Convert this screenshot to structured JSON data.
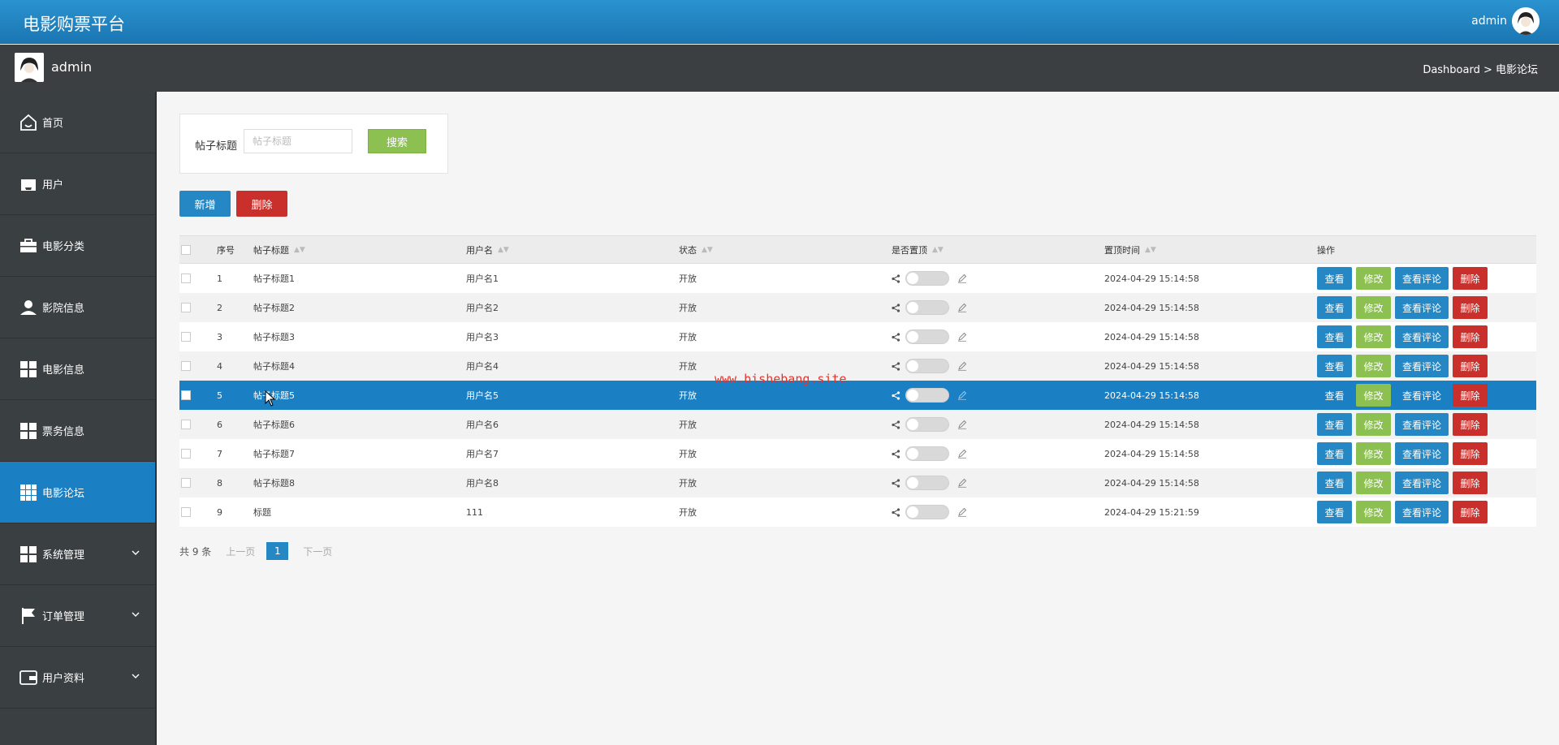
{
  "app": {
    "title": "电影购票平台",
    "user": "admin"
  },
  "subbar": {
    "user": "admin",
    "breadcrumb": "Dashboard > 电影论坛"
  },
  "sidebar": {
    "items": [
      {
        "label": "首页",
        "icon": "home-icon"
      },
      {
        "label": "用户",
        "icon": "inbox-icon"
      },
      {
        "label": "电影分类",
        "icon": "briefcase-icon"
      },
      {
        "label": "影院信息",
        "icon": "person-icon"
      },
      {
        "label": "电影信息",
        "icon": "grid-icon"
      },
      {
        "label": "票务信息",
        "icon": "grid-icon"
      },
      {
        "label": "电影论坛",
        "icon": "grid-small-icon",
        "active": true
      },
      {
        "label": "系统管理",
        "icon": "grid-icon",
        "expandable": true
      },
      {
        "label": "订单管理",
        "icon": "flag-icon",
        "expandable": true
      },
      {
        "label": "用户资料",
        "icon": "wallet-icon",
        "expandable": true
      }
    ]
  },
  "search": {
    "label": "帖子标题",
    "placeholder": "帖子标题",
    "button": "搜索"
  },
  "toolbar": {
    "add": "新增",
    "delete": "删除"
  },
  "table": {
    "headers": [
      "序号",
      "帖子标题",
      "用户名",
      "状态",
      "是否置顶",
      "置顶时间",
      "操作"
    ],
    "actions": {
      "view": "查看",
      "edit": "修改",
      "comments": "查看评论",
      "delete": "删除"
    },
    "rows": [
      {
        "no": "1",
        "title": "帖子标题1",
        "user": "用户名1",
        "status": "开放",
        "time": "2024-04-29 15:14:58"
      },
      {
        "no": "2",
        "title": "帖子标题2",
        "user": "用户名2",
        "status": "开放",
        "time": "2024-04-29 15:14:58"
      },
      {
        "no": "3",
        "title": "帖子标题3",
        "user": "用户名3",
        "status": "开放",
        "time": "2024-04-29 15:14:58"
      },
      {
        "no": "4",
        "title": "帖子标题4",
        "user": "用户名4",
        "status": "开放",
        "time": "2024-04-29 15:14:58"
      },
      {
        "no": "5",
        "title": "帖子标题5",
        "user": "用户名5",
        "status": "开放",
        "time": "2024-04-29 15:14:58",
        "selected": true
      },
      {
        "no": "6",
        "title": "帖子标题6",
        "user": "用户名6",
        "status": "开放",
        "time": "2024-04-29 15:14:58"
      },
      {
        "no": "7",
        "title": "帖子标题7",
        "user": "用户名7",
        "status": "开放",
        "time": "2024-04-29 15:14:58"
      },
      {
        "no": "8",
        "title": "帖子标题8",
        "user": "用户名8",
        "status": "开放",
        "time": "2024-04-29 15:14:58"
      },
      {
        "no": "9",
        "title": "标题",
        "user": "111",
        "status": "开放",
        "time": "2024-04-29 15:21:59"
      }
    ]
  },
  "pager": {
    "total": "共 9 条",
    "prev": "上一页",
    "current": "1",
    "next": "下一页"
  },
  "watermark": "www.bishebang.site",
  "colors": {
    "primary": "#2588c4",
    "success": "#8cc152",
    "danger": "#c9302c",
    "sidebar": "#3a3f41"
  }
}
